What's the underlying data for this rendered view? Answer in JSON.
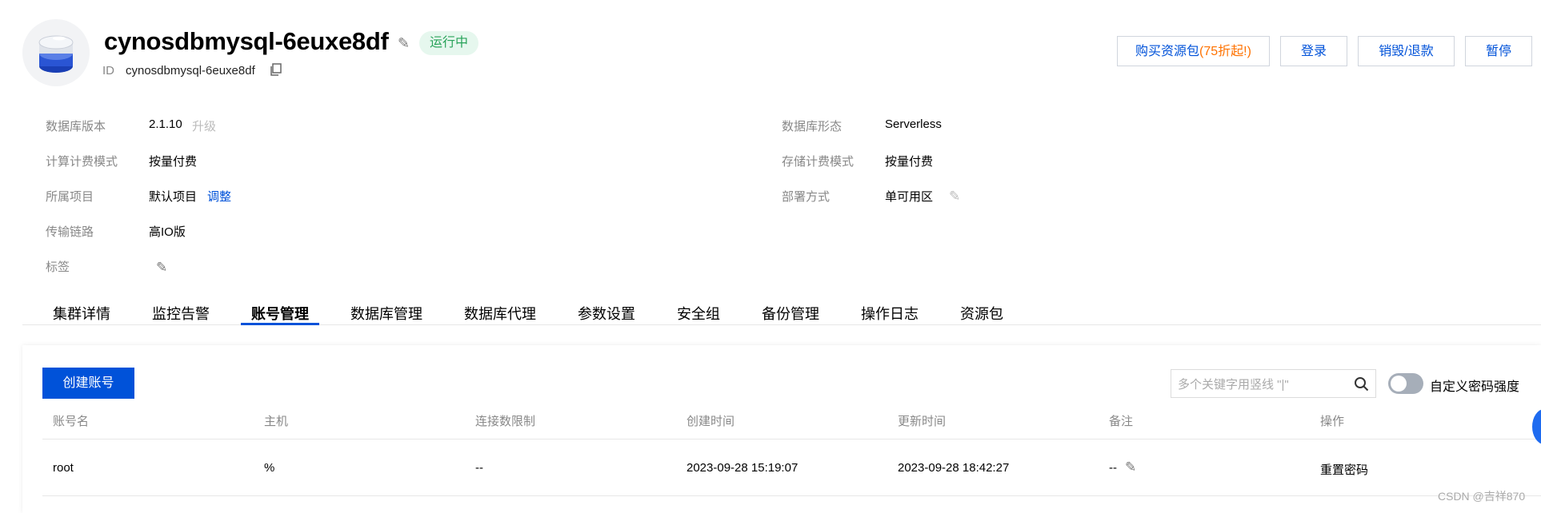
{
  "header": {
    "instance_name": "cynosdbmysql-6euxe8df",
    "status": "运行中",
    "id_label": "ID",
    "id_value": "cynosdbmysql-6euxe8df",
    "colors": {
      "accent": "#0052d9",
      "status_bg": "#e6f7ee",
      "status_text": "#29a35a",
      "highlight": "#ff7200"
    }
  },
  "actions": {
    "buy_label": "购买资源包",
    "buy_highlight": "(75折起!)",
    "login": "登录",
    "destroy": "销毁/退款",
    "pause": "暂停"
  },
  "info": {
    "db_version_label": "数据库版本",
    "db_version_value": "2.1.10",
    "upgrade": "升级",
    "compute_billing_label": "计算计费模式",
    "compute_billing_value": "按量付费",
    "project_label": "所属项目",
    "project_value": "默认项目",
    "adjust": "调整",
    "transport_label": "传输链路",
    "transport_value": "高IO版",
    "tags_label": "标签",
    "db_form_label": "数据库形态",
    "db_form_value": "Serverless",
    "storage_billing_label": "存储计费模式",
    "storage_billing_value": "按量付费",
    "deploy_label": "部署方式",
    "deploy_value": "单可用区"
  },
  "tabs": [
    "集群详情",
    "监控告警",
    "账号管理",
    "数据库管理",
    "数据库代理",
    "参数设置",
    "安全组",
    "备份管理",
    "操作日志",
    "资源包"
  ],
  "active_tab": "账号管理",
  "accounts": {
    "create_button": "创建账号",
    "search_placeholder": "多个关键字用竖线 \"|\"",
    "custom_password_label": "自定义密码强度",
    "columns": [
      "账号名",
      "主机",
      "连接数限制",
      "创建时间",
      "更新时间",
      "备注",
      "操作"
    ],
    "rows": [
      {
        "name": "root",
        "host": "%",
        "conn_limit": "--",
        "created": "2023-09-28 15:19:07",
        "updated": "2023-09-28 18:42:27",
        "remark": "--",
        "action": "重置密码"
      }
    ]
  },
  "watermark": "CSDN @吉祥870"
}
